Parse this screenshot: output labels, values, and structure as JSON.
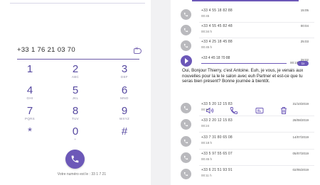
{
  "dialer": {
    "number": "+33 1 76 21 03 70",
    "own_number_label": "Votre numéro est le : 33 1 7  21 ",
    "keys": [
      {
        "digit": "1",
        "letters": ""
      },
      {
        "digit": "2",
        "letters": "ABC"
      },
      {
        "digit": "3",
        "letters": "DEF"
      },
      {
        "digit": "4",
        "letters": "GHI"
      },
      {
        "digit": "5",
        "letters": "JKL"
      },
      {
        "digit": "6",
        "letters": "MNO"
      },
      {
        "digit": "7",
        "letters": "PQRS"
      },
      {
        "digit": "8",
        "letters": "TUV"
      },
      {
        "digit": "9",
        "letters": "WXYZ"
      },
      {
        "digit": "*",
        "letters": ""
      },
      {
        "digit": "0",
        "letters": "+"
      },
      {
        "digit": "#",
        "letters": ""
      }
    ]
  },
  "call_log": {
    "rows_top": [
      {
        "number": "+33 4 55 18 82 88",
        "sub": "00:45",
        "date": "15:05"
      },
      {
        "number": "+33 4 55 45 82 48",
        "sub": "00:34 h",
        "date": "00:04"
      },
      {
        "number": "+33 4 25 18 45 88",
        "sub": "00:45 h",
        "date": "25:03"
      }
    ],
    "expanded": {
      "number": "+33 4 45 18 70 88",
      "date": "28:02",
      "duration": "00:15",
      "speed": "1x",
      "progress": 1.0,
      "transcript": "Oui, Bonjour Thierry, c'est Antoine. Euh, je vous, je venais aux nouvelles pour la le le salon avec euh Partner et est-ce que tu seras bien présent? Bonne journée à bientôt."
    },
    "rows_bottom": [
      {
        "number": "+33 5 20 12 15 83",
        "sub": "00:11",
        "date": "31/10/2019"
      },
      {
        "number": "+33 2 20 12 15 83",
        "sub": "00:24",
        "date": "28/08/2019"
      },
      {
        "number": "+33 7 31 80 65 08",
        "sub": "00:18 h",
        "date": "14/07/2019"
      },
      {
        "number": "+33 5 97 55 65 07",
        "sub": "00:45 h",
        "date": "05/07/2019"
      },
      {
        "number": "+33 6 21 51 93 91",
        "sub": "00:11 h",
        "date": "02/05/2019"
      }
    ]
  },
  "colors": {
    "accent": "#6c58b8",
    "avatar": "#b9b9bd"
  }
}
